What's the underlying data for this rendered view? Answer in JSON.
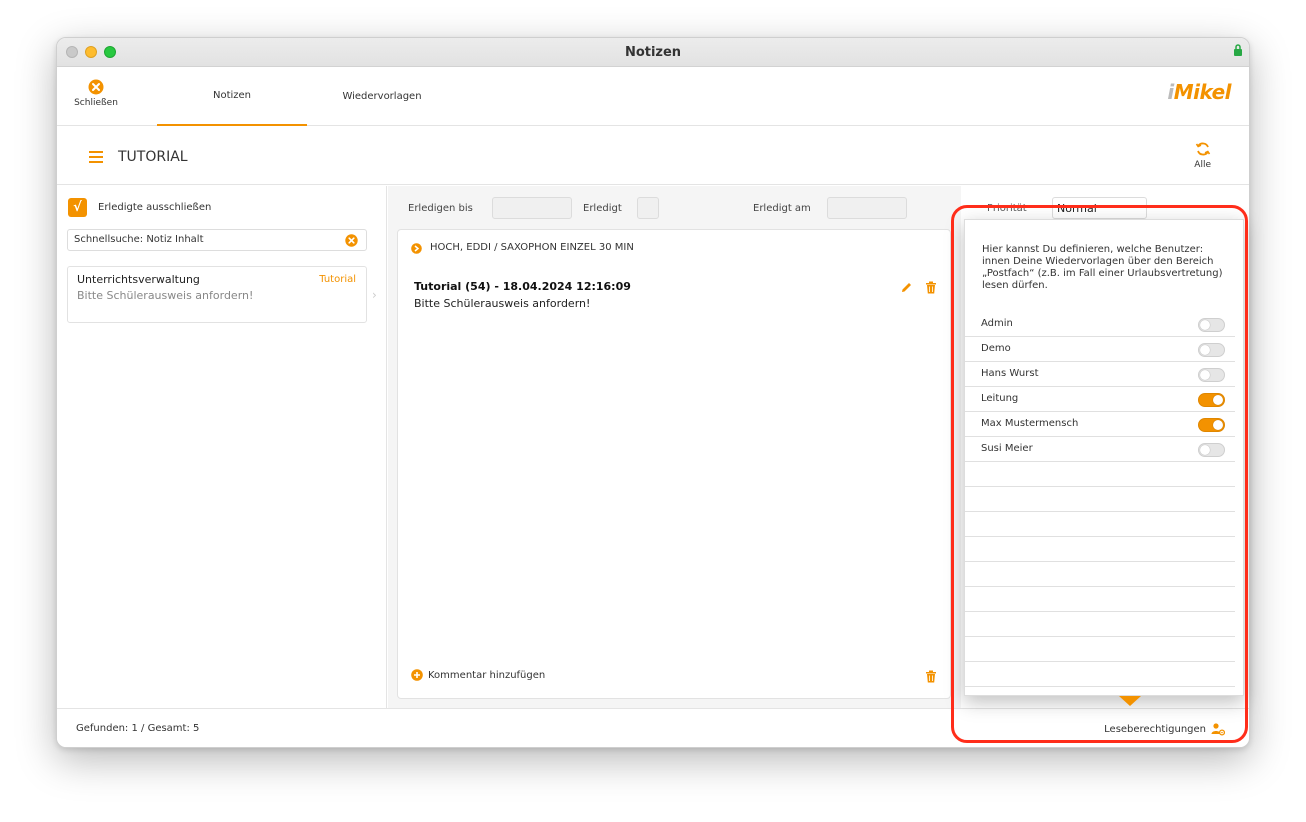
{
  "window": {
    "title": "Notizen"
  },
  "toolbar": {
    "close_label": "Schließen",
    "tabs": [
      {
        "label": "Notizen"
      },
      {
        "label": "Wiedervorlagen"
      }
    ],
    "logo": {
      "prefix": "i",
      "text": "Mikel"
    }
  },
  "header": {
    "title": "TUTORIAL",
    "alle_label": "Alle"
  },
  "left": {
    "exclude_done_label": "Erledigte ausschließen",
    "search_placeholder": "Schnellsuche: Notiz Inhalt",
    "note": {
      "title": "Unterrichtsverwaltung",
      "category": "Tutorial",
      "snippet": "Bitte Schülerausweis anfordern!"
    }
  },
  "middle": {
    "erledigen_bis_label": "Erledigen bis",
    "erledigt_label": "Erledigt",
    "erledigt_am_label": "Erledigt am",
    "student": "HOCH, EDDI / SAXOPHON EINZEL 30 MIN",
    "note_title": "Tutorial (54) - 18.04.2024 12:16:09",
    "note_text": "Bitte Schülerausweis anfordern!",
    "add_comment_label": "Kommentar hinzufügen"
  },
  "right": {
    "prio_label": "Priorität",
    "prio_value": "Normal"
  },
  "status": {
    "text": "Gefunden: 1 / Gesamt: 5",
    "lese_label": "Leseberechtigungen"
  },
  "popover": {
    "description": "Hier kannst Du definieren, welche Benutzer: innen Deine Wiedervorlagen über den Bereich „Postfach“ (z.B. im Fall einer Urlaubsvertretung) lesen dürfen.",
    "users": [
      {
        "name": "Admin",
        "enabled": false
      },
      {
        "name": "Demo",
        "enabled": false
      },
      {
        "name": "Hans Wurst",
        "enabled": false
      },
      {
        "name": "Leitung",
        "enabled": true
      },
      {
        "name": "Max Mustermensch",
        "enabled": true
      },
      {
        "name": "Susi Meier",
        "enabled": false
      }
    ]
  },
  "colors": {
    "accent": "#f39200",
    "highlight": "#ff2d1a"
  }
}
